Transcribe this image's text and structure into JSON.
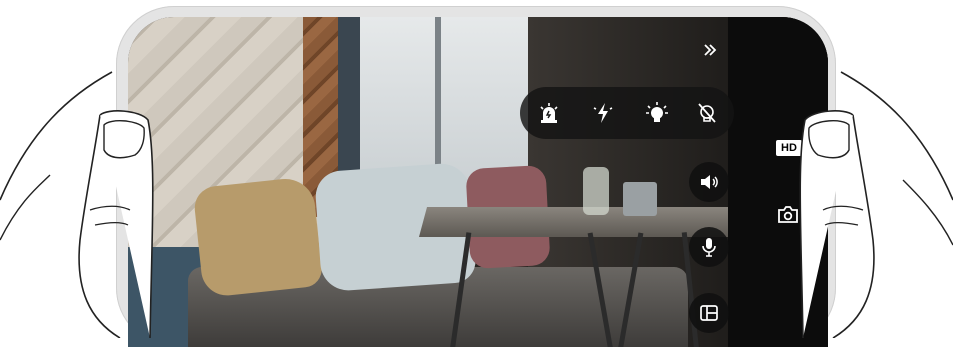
{
  "camera_view": {
    "expand_icon": "chevrons-right-icon",
    "light_controls": [
      {
        "name": "siren-icon"
      },
      {
        "name": "flash-icon"
      },
      {
        "name": "light-bulb-icon"
      },
      {
        "name": "light-off-icon"
      }
    ],
    "speaker_icon": "speaker-icon",
    "microphone_icon": "microphone-icon",
    "layout_icon": "layout-icon",
    "hd_label": "HD",
    "snapshot_icon": "camera-icon"
  },
  "colors": {
    "frame": "#e4e4e4",
    "control_bg": "#141414",
    "icon": "#ffffff"
  }
}
